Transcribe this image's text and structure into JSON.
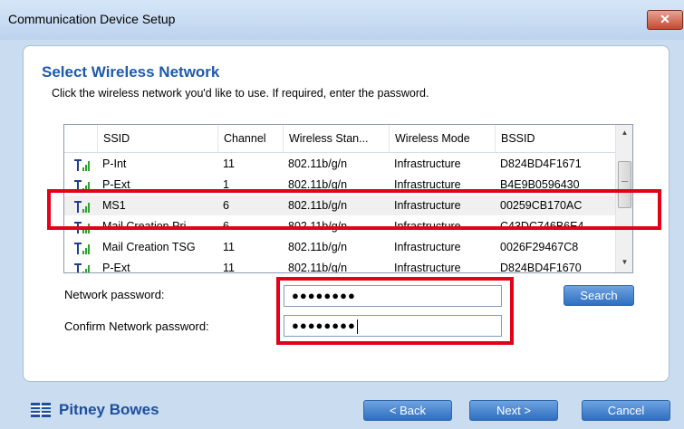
{
  "window": {
    "title": "Communication Device Setup",
    "close_glyph": "✕"
  },
  "page": {
    "heading": "Select Wireless Network",
    "instructions": "Click the wireless network you'd like to use. If required, enter the password."
  },
  "network_list": {
    "columns": [
      "SSID",
      "Channel",
      "Wireless Stan...",
      "Wireless Mode",
      "BSSID"
    ],
    "rows": [
      {
        "ssid": "P-Int",
        "channel": "11",
        "standard": "802.11b/g/n",
        "mode": "Infrastructure",
        "bssid": "D824BD4F1671",
        "selected": false
      },
      {
        "ssid": "P-Ext",
        "channel": "1",
        "standard": "802.11b/g/n",
        "mode": "Infrastructure",
        "bssid": "B4E9B0596430",
        "selected": false
      },
      {
        "ssid": "MS1",
        "channel": "6",
        "standard": "802.11b/g/n",
        "mode": "Infrastructure",
        "bssid": "00259CB170AC",
        "selected": true
      },
      {
        "ssid": "Mail Creation Pri...",
        "channel": "6",
        "standard": "802.11b/g/n",
        "mode": "Infrastructure",
        "bssid": "C43DC746B6E4",
        "selected": false
      },
      {
        "ssid": "Mail Creation TSG",
        "channel": "11",
        "standard": "802.11b/g/n",
        "mode": "Infrastructure",
        "bssid": "0026F29467C8",
        "selected": false
      },
      {
        "ssid": "P-Ext",
        "channel": "11",
        "standard": "802.11b/g/n",
        "mode": "Infrastructure",
        "bssid": "D824BD4F1670",
        "selected": false
      }
    ]
  },
  "form": {
    "network_password_label": "Network password:",
    "confirm_password_label": "Confirm Network password:",
    "network_password_value": "●●●●●●●●",
    "confirm_password_value": "●●●●●●●●",
    "search_label": "Search"
  },
  "footer": {
    "brand": "Pitney Bowes",
    "back_label": "< Back",
    "next_label": "Next >",
    "cancel_label": "Cancel"
  },
  "colors": {
    "accent": "#1e5aa8",
    "highlight": "#e2001a",
    "button": "#2e6fc1"
  },
  "icons": {
    "signal": "wifi-signal-icon",
    "close": "close-icon"
  }
}
